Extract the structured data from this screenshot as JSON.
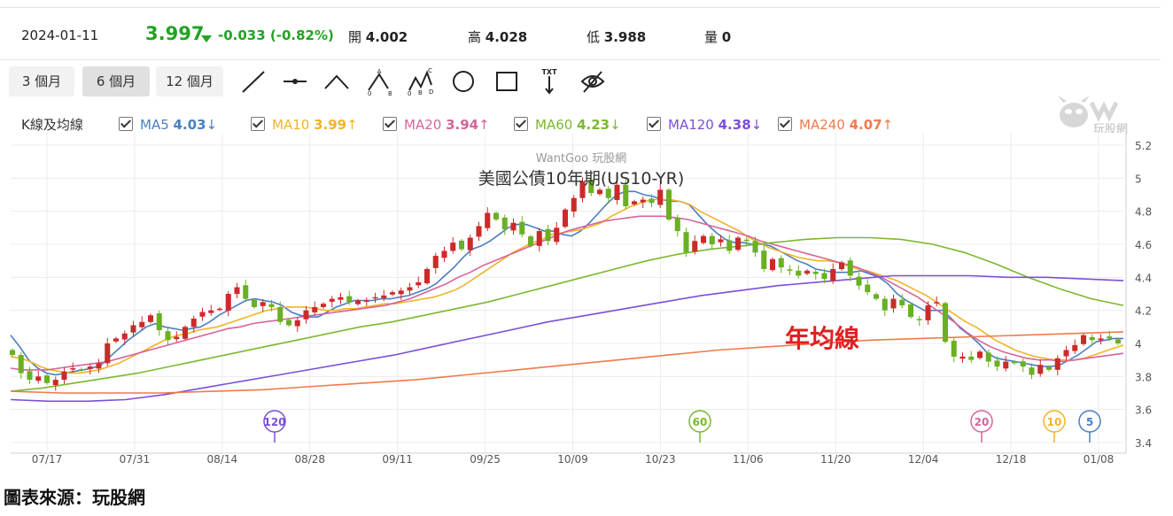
{
  "quote": {
    "date": "2024-01-11",
    "price": "3.997",
    "change": "-0.033 (-0.82%)",
    "open_label": "開",
    "open": "4.002",
    "high_label": "高",
    "high": "4.028",
    "low_label": "低",
    "low": "3.988",
    "vol_label": "量",
    "vol": "0"
  },
  "tabs": [
    {
      "label": "3 個月",
      "active": false
    },
    {
      "label": "6 個月",
      "active": true
    },
    {
      "label": "12 個月",
      "active": false
    }
  ],
  "tools": [
    "line-tool-icon",
    "horizontal-line-tool-icon",
    "polyline-tool-icon",
    "abc-pattern-tool-icon",
    "abcd-pattern-tool-icon",
    "circle-tool-icon",
    "rectangle-tool-icon",
    "text-tool-icon",
    "hide-drawings-icon"
  ],
  "legend": {
    "label": "K線及均線",
    "items": [
      {
        "name": "MA5",
        "value": "4.03",
        "arrow": "↓",
        "color": "#4a7fc1"
      },
      {
        "name": "MA10",
        "value": "3.99",
        "arrow": "↑",
        "color": "#f0b429"
      },
      {
        "name": "MA20",
        "value": "3.94",
        "arrow": "↑",
        "color": "#d6649c"
      },
      {
        "name": "MA60",
        "value": "4.23",
        "arrow": "↓",
        "color": "#7cb82f"
      },
      {
        "name": "MA120",
        "value": "4.38",
        "arrow": "↓",
        "color": "#7b4fd6"
      },
      {
        "name": "MA240",
        "value": "4.07",
        "arrow": "↑",
        "color": "#f07a4a"
      }
    ]
  },
  "logo_text": "玩股網",
  "source_text": "圖表來源：玩股網",
  "colors": {
    "up": "#cc2a2a",
    "down": "#6ab023",
    "accent": "#22a322"
  },
  "chart_data": {
    "type": "candlestick",
    "title": "美國公債10年期(US10-YR)",
    "watermark": "WantGoo 玩股網",
    "annotation": "年均線",
    "x_labels": [
      "07/17",
      "07/31",
      "08/14",
      "08/28",
      "09/11",
      "09/25",
      "10/09",
      "10/23",
      "11/06",
      "11/20",
      "12/04",
      "12/18",
      "01/08"
    ],
    "y_ticks": [
      "5.2",
      "5",
      "4.8",
      "4.6",
      "4.4",
      "4.2",
      "4",
      "3.8",
      "3.6",
      "3.4"
    ],
    "ylim": [
      3.4,
      5.2
    ],
    "close": [
      3.93,
      3.82,
      3.78,
      3.8,
      3.76,
      3.78,
      3.83,
      3.85,
      3.84,
      3.86,
      3.88,
      4.0,
      4.03,
      4.06,
      4.11,
      4.13,
      4.17,
      4.08,
      4.02,
      4.04,
      4.1,
      4.15,
      4.19,
      4.2,
      4.21,
      4.3,
      4.34,
      4.27,
      4.22,
      4.25,
      4.22,
      4.13,
      4.11,
      4.14,
      4.2,
      4.22,
      4.24,
      4.27,
      4.28,
      4.25,
      4.26,
      4.26,
      4.28,
      4.29,
      4.31,
      4.32,
      4.34,
      4.37,
      4.45,
      4.53,
      4.56,
      4.61,
      4.57,
      4.64,
      4.71,
      4.79,
      4.75,
      4.69,
      4.73,
      4.66,
      4.59,
      4.68,
      4.62,
      4.7,
      4.81,
      4.88,
      4.98,
      4.91,
      4.93,
      4.88,
      4.96,
      4.83,
      4.86,
      4.87,
      4.85,
      4.93,
      4.75,
      4.68,
      4.55,
      4.62,
      4.65,
      4.6,
      4.63,
      4.56,
      4.64,
      4.62,
      4.55,
      4.45,
      4.51,
      4.46,
      4.44,
      4.41,
      4.44,
      4.42,
      4.39,
      4.45,
      4.49,
      4.41,
      4.35,
      4.31,
      4.27,
      4.2,
      4.27,
      4.23,
      4.16,
      4.14,
      4.23,
      4.25,
      4.01,
      3.92,
      3.92,
      3.9,
      3.95,
      3.89,
      3.86,
      3.89,
      3.88,
      3.86,
      3.81,
      3.87,
      3.84,
      3.91,
      3.96,
      3.99,
      4.05,
      4.02,
      4.03,
      4.03,
      4.0
    ],
    "ma": [
      {
        "name": "MA5",
        "color": "#4a7fc1",
        "values": [
          4.05,
          3.98,
          3.9,
          3.85,
          3.82,
          3.81,
          3.82,
          3.83,
          3.84,
          3.85,
          3.87,
          3.92,
          3.97,
          4.02,
          4.06,
          4.1,
          4.12,
          4.1,
          4.09,
          4.08,
          4.09,
          4.1,
          4.13,
          4.17,
          4.2,
          4.23,
          4.26,
          4.27,
          4.26,
          4.25,
          4.23,
          4.19,
          4.17,
          4.16,
          4.16,
          4.19,
          4.22,
          4.24,
          4.26,
          4.26,
          4.26,
          4.27,
          4.27,
          4.28,
          4.29,
          4.31,
          4.33,
          4.36,
          4.41,
          4.46,
          4.52,
          4.57,
          4.59,
          4.62,
          4.66,
          4.7,
          4.72,
          4.72,
          4.7,
          4.68,
          4.68,
          4.66,
          4.65,
          4.68,
          4.73,
          4.79,
          4.85,
          4.9,
          4.92,
          4.92,
          4.9,
          4.89,
          4.87,
          4.86,
          4.86,
          4.84,
          4.78,
          4.72,
          4.67,
          4.63,
          4.61,
          4.61,
          4.6,
          4.6,
          4.59,
          4.56,
          4.53,
          4.5,
          4.48,
          4.45,
          4.44,
          4.43,
          4.43,
          4.43,
          4.44,
          4.42,
          4.4,
          4.36,
          4.3,
          4.26,
          4.23,
          4.2,
          4.2,
          4.2,
          4.15,
          4.09,
          4.05,
          4.0,
          3.94,
          3.91,
          3.9,
          3.89,
          3.88,
          3.87,
          3.86,
          3.86,
          3.87,
          3.9,
          3.93,
          3.97,
          4.01,
          4.02,
          4.03,
          4.03
        ]
      },
      {
        "name": "MA10",
        "color": "#f0b429",
        "values": [
          3.92,
          3.91,
          3.89,
          3.86,
          3.84,
          3.83,
          3.82,
          3.82,
          3.83,
          3.84,
          3.86,
          3.88,
          3.91,
          3.94,
          3.97,
          4.0,
          4.03,
          4.05,
          4.06,
          4.08,
          4.09,
          4.1,
          4.12,
          4.14,
          4.16,
          4.18,
          4.2,
          4.21,
          4.22,
          4.22,
          4.22,
          4.21,
          4.2,
          4.2,
          4.21,
          4.21,
          4.22,
          4.23,
          4.24,
          4.24,
          4.25,
          4.26,
          4.27,
          4.28,
          4.3,
          4.32,
          4.35,
          4.39,
          4.43,
          4.47,
          4.51,
          4.55,
          4.58,
          4.61,
          4.63,
          4.66,
          4.67,
          4.68,
          4.69,
          4.71,
          4.73,
          4.77,
          4.8,
          4.83,
          4.85,
          4.87,
          4.87,
          4.87,
          4.86,
          4.84,
          4.8,
          4.77,
          4.74,
          4.71,
          4.68,
          4.64,
          4.61,
          4.58,
          4.56,
          4.54,
          4.52,
          4.51,
          4.5,
          4.5,
          4.49,
          4.47,
          4.45,
          4.44,
          4.42,
          4.4,
          4.38,
          4.35,
          4.32,
          4.29,
          4.25,
          4.21,
          4.17,
          4.13,
          4.1,
          4.06,
          4.02,
          3.99,
          3.96,
          3.94,
          3.92,
          3.91,
          3.9,
          3.9,
          3.9,
          3.91,
          3.93,
          3.95,
          3.97,
          3.99
        ]
      },
      {
        "name": "MA20",
        "color": "#d6649c",
        "values": [
          3.85,
          3.84,
          3.84,
          3.84,
          3.85,
          3.86,
          3.87,
          3.88,
          3.89,
          3.91,
          3.93,
          3.95,
          3.97,
          3.99,
          4.01,
          4.03,
          4.05,
          4.07,
          4.09,
          4.1,
          4.12,
          4.13,
          4.14,
          4.15,
          4.16,
          4.17,
          4.18,
          4.19,
          4.2,
          4.21,
          4.22,
          4.23,
          4.25,
          4.27,
          4.3,
          4.33,
          4.36,
          4.4,
          4.43,
          4.47,
          4.5,
          4.53,
          4.56,
          4.59,
          4.62,
          4.65,
          4.68,
          4.7,
          4.72,
          4.74,
          4.75,
          4.76,
          4.77,
          4.77,
          4.77,
          4.76,
          4.75,
          4.73,
          4.71,
          4.69,
          4.67,
          4.65,
          4.62,
          4.6,
          4.58,
          4.56,
          4.54,
          4.52,
          4.5,
          4.48,
          4.46,
          4.43,
          4.4,
          4.36,
          4.32,
          4.28,
          4.23,
          4.18,
          4.13,
          4.07,
          4.02,
          3.98,
          3.95,
          3.93,
          3.91,
          3.9,
          3.9,
          3.89,
          3.9,
          3.91,
          3.92,
          3.93,
          3.94
        ]
      },
      {
        "name": "MA60",
        "color": "#7cb82f",
        "values": [
          3.71,
          3.73,
          3.76,
          3.79,
          3.82,
          3.86,
          3.9,
          3.94,
          3.98,
          4.02,
          4.06,
          4.1,
          4.13,
          4.17,
          4.21,
          4.25,
          4.3,
          4.35,
          4.4,
          4.45,
          4.5,
          4.54,
          4.57,
          4.59,
          4.61,
          4.63,
          4.64,
          4.64,
          4.63,
          4.6,
          4.55,
          4.48,
          4.4,
          4.33,
          4.27,
          4.23
        ]
      },
      {
        "name": "MA120",
        "color": "#7b4fd6",
        "values": [
          3.66,
          3.65,
          3.65,
          3.66,
          3.69,
          3.73,
          3.77,
          3.81,
          3.85,
          3.89,
          3.93,
          3.98,
          4.03,
          4.08,
          4.13,
          4.17,
          4.21,
          4.25,
          4.29,
          4.32,
          4.35,
          4.37,
          4.39,
          4.41,
          4.41,
          4.41,
          4.4,
          4.4,
          4.39,
          4.38
        ]
      },
      {
        "name": "MA240",
        "color": "#f07a4a",
        "values": [
          3.71,
          3.7,
          3.7,
          3.7,
          3.71,
          3.72,
          3.74,
          3.76,
          3.78,
          3.81,
          3.84,
          3.87,
          3.9,
          3.93,
          3.96,
          3.98,
          4.0,
          4.02,
          4.03,
          4.04,
          4.05,
          4.06,
          4.07
        ]
      }
    ],
    "markers": [
      {
        "label": "120",
        "color": "#7b4fd6"
      },
      {
        "label": "60",
        "color": "#7cb82f"
      },
      {
        "label": "20",
        "color": "#d6649c"
      },
      {
        "label": "10",
        "color": "#f0b429"
      },
      {
        "label": "5",
        "color": "#4a7fc1"
      }
    ]
  }
}
